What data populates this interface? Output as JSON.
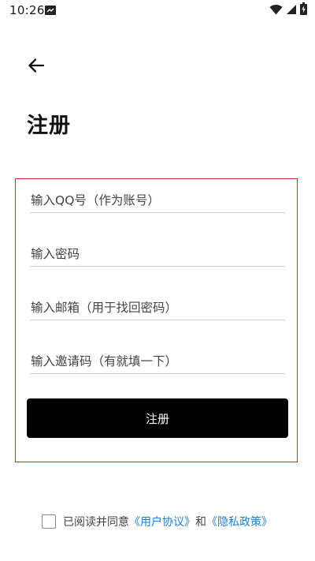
{
  "status_bar": {
    "time": "10:26",
    "icons": [
      "notification-icon",
      "wifi-icon",
      "cellular-signal-icon",
      "battery-charging-icon"
    ]
  },
  "header": {
    "back_icon": "arrow-left-icon",
    "title": "注册"
  },
  "form": {
    "border_color": "#e1242a",
    "qq_placeholder": "输入QQ号（作为账号）",
    "password_placeholder": "输入密码",
    "email_placeholder": "输入邮箱（用于找回密码）",
    "invite_placeholder": "输入邀请码（有就填一下）",
    "submit_label": "注册"
  },
  "agreement": {
    "checked": false,
    "prefix": "已阅读并同意",
    "user_agreement": "《用户协议》",
    "joiner": "和",
    "privacy_policy": "《隐私政策》",
    "link_color": "#1f7fd4"
  }
}
